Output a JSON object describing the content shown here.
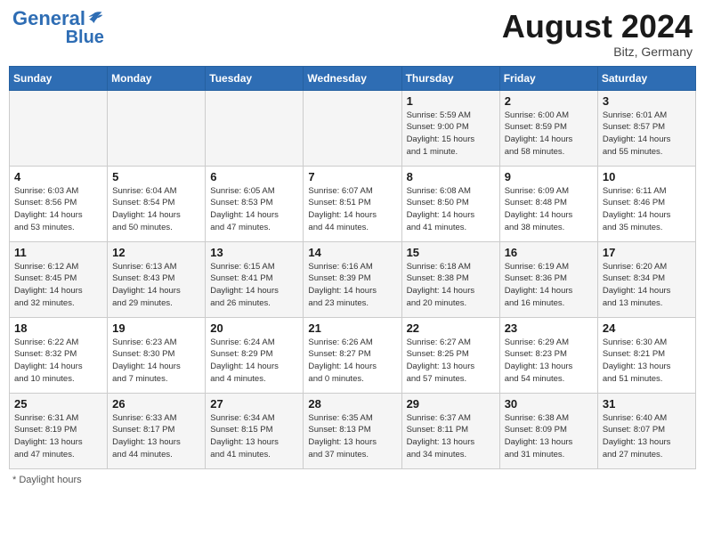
{
  "header": {
    "logo_general": "General",
    "logo_blue": "Blue",
    "month_year": "August 2024",
    "location": "Bitz, Germany"
  },
  "days_of_week": [
    "Sunday",
    "Monday",
    "Tuesday",
    "Wednesday",
    "Thursday",
    "Friday",
    "Saturday"
  ],
  "weeks": [
    [
      {
        "num": "",
        "info": ""
      },
      {
        "num": "",
        "info": ""
      },
      {
        "num": "",
        "info": ""
      },
      {
        "num": "",
        "info": ""
      },
      {
        "num": "1",
        "info": "Sunrise: 5:59 AM\nSunset: 9:00 PM\nDaylight: 15 hours\nand 1 minute."
      },
      {
        "num": "2",
        "info": "Sunrise: 6:00 AM\nSunset: 8:59 PM\nDaylight: 14 hours\nand 58 minutes."
      },
      {
        "num": "3",
        "info": "Sunrise: 6:01 AM\nSunset: 8:57 PM\nDaylight: 14 hours\nand 55 minutes."
      }
    ],
    [
      {
        "num": "4",
        "info": "Sunrise: 6:03 AM\nSunset: 8:56 PM\nDaylight: 14 hours\nand 53 minutes."
      },
      {
        "num": "5",
        "info": "Sunrise: 6:04 AM\nSunset: 8:54 PM\nDaylight: 14 hours\nand 50 minutes."
      },
      {
        "num": "6",
        "info": "Sunrise: 6:05 AM\nSunset: 8:53 PM\nDaylight: 14 hours\nand 47 minutes."
      },
      {
        "num": "7",
        "info": "Sunrise: 6:07 AM\nSunset: 8:51 PM\nDaylight: 14 hours\nand 44 minutes."
      },
      {
        "num": "8",
        "info": "Sunrise: 6:08 AM\nSunset: 8:50 PM\nDaylight: 14 hours\nand 41 minutes."
      },
      {
        "num": "9",
        "info": "Sunrise: 6:09 AM\nSunset: 8:48 PM\nDaylight: 14 hours\nand 38 minutes."
      },
      {
        "num": "10",
        "info": "Sunrise: 6:11 AM\nSunset: 8:46 PM\nDaylight: 14 hours\nand 35 minutes."
      }
    ],
    [
      {
        "num": "11",
        "info": "Sunrise: 6:12 AM\nSunset: 8:45 PM\nDaylight: 14 hours\nand 32 minutes."
      },
      {
        "num": "12",
        "info": "Sunrise: 6:13 AM\nSunset: 8:43 PM\nDaylight: 14 hours\nand 29 minutes."
      },
      {
        "num": "13",
        "info": "Sunrise: 6:15 AM\nSunset: 8:41 PM\nDaylight: 14 hours\nand 26 minutes."
      },
      {
        "num": "14",
        "info": "Sunrise: 6:16 AM\nSunset: 8:39 PM\nDaylight: 14 hours\nand 23 minutes."
      },
      {
        "num": "15",
        "info": "Sunrise: 6:18 AM\nSunset: 8:38 PM\nDaylight: 14 hours\nand 20 minutes."
      },
      {
        "num": "16",
        "info": "Sunrise: 6:19 AM\nSunset: 8:36 PM\nDaylight: 14 hours\nand 16 minutes."
      },
      {
        "num": "17",
        "info": "Sunrise: 6:20 AM\nSunset: 8:34 PM\nDaylight: 14 hours\nand 13 minutes."
      }
    ],
    [
      {
        "num": "18",
        "info": "Sunrise: 6:22 AM\nSunset: 8:32 PM\nDaylight: 14 hours\nand 10 minutes."
      },
      {
        "num": "19",
        "info": "Sunrise: 6:23 AM\nSunset: 8:30 PM\nDaylight: 14 hours\nand 7 minutes."
      },
      {
        "num": "20",
        "info": "Sunrise: 6:24 AM\nSunset: 8:29 PM\nDaylight: 14 hours\nand 4 minutes."
      },
      {
        "num": "21",
        "info": "Sunrise: 6:26 AM\nSunset: 8:27 PM\nDaylight: 14 hours\nand 0 minutes."
      },
      {
        "num": "22",
        "info": "Sunrise: 6:27 AM\nSunset: 8:25 PM\nDaylight: 13 hours\nand 57 minutes."
      },
      {
        "num": "23",
        "info": "Sunrise: 6:29 AM\nSunset: 8:23 PM\nDaylight: 13 hours\nand 54 minutes."
      },
      {
        "num": "24",
        "info": "Sunrise: 6:30 AM\nSunset: 8:21 PM\nDaylight: 13 hours\nand 51 minutes."
      }
    ],
    [
      {
        "num": "25",
        "info": "Sunrise: 6:31 AM\nSunset: 8:19 PM\nDaylight: 13 hours\nand 47 minutes."
      },
      {
        "num": "26",
        "info": "Sunrise: 6:33 AM\nSunset: 8:17 PM\nDaylight: 13 hours\nand 44 minutes."
      },
      {
        "num": "27",
        "info": "Sunrise: 6:34 AM\nSunset: 8:15 PM\nDaylight: 13 hours\nand 41 minutes."
      },
      {
        "num": "28",
        "info": "Sunrise: 6:35 AM\nSunset: 8:13 PM\nDaylight: 13 hours\nand 37 minutes."
      },
      {
        "num": "29",
        "info": "Sunrise: 6:37 AM\nSunset: 8:11 PM\nDaylight: 13 hours\nand 34 minutes."
      },
      {
        "num": "30",
        "info": "Sunrise: 6:38 AM\nSunset: 8:09 PM\nDaylight: 13 hours\nand 31 minutes."
      },
      {
        "num": "31",
        "info": "Sunrise: 6:40 AM\nSunset: 8:07 PM\nDaylight: 13 hours\nand 27 minutes."
      }
    ]
  ],
  "footer": "Daylight hours"
}
